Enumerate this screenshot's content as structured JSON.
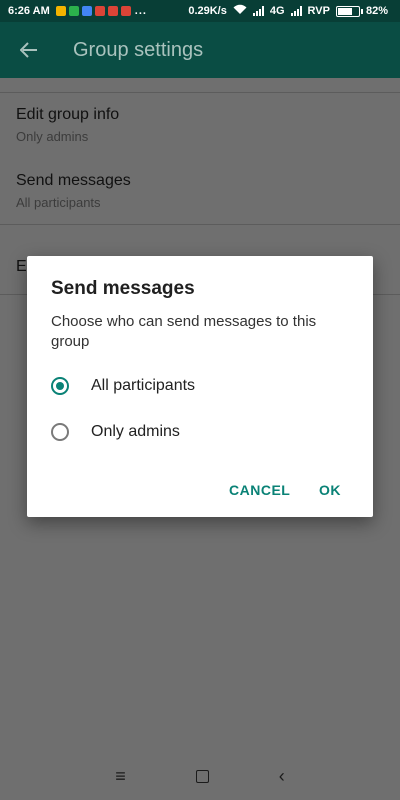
{
  "status_bar": {
    "time": "6:26 AM",
    "notif_colors": [
      "#f4b400",
      "#2bb24c",
      "#4285f4",
      "#db4437",
      "#db4437",
      "#db4437"
    ],
    "dots": "...",
    "net_speed": "0.29K/s",
    "network": "4G",
    "carrier": "RVP",
    "battery": "82%",
    "battery_level": 0.82
  },
  "app_bar": {
    "title": "Group settings",
    "back_icon": "arrow-back-icon"
  },
  "settings": [
    {
      "primary": "Edit group info",
      "secondary": "Only admins"
    },
    {
      "primary": "Send messages",
      "secondary": "All participants"
    },
    {
      "primary": "E",
      "secondary": ""
    }
  ],
  "dialog": {
    "title": "Send messages",
    "message": "Choose who can send messages to this group",
    "options": [
      {
        "label": "All participants",
        "checked": true
      },
      {
        "label": "Only admins",
        "checked": false
      }
    ],
    "cancel_label": "CANCEL",
    "ok_label": "OK"
  },
  "nav_bar": {
    "menu_icon": "≡",
    "home_icon": "square-icon",
    "back_icon": "‹"
  }
}
